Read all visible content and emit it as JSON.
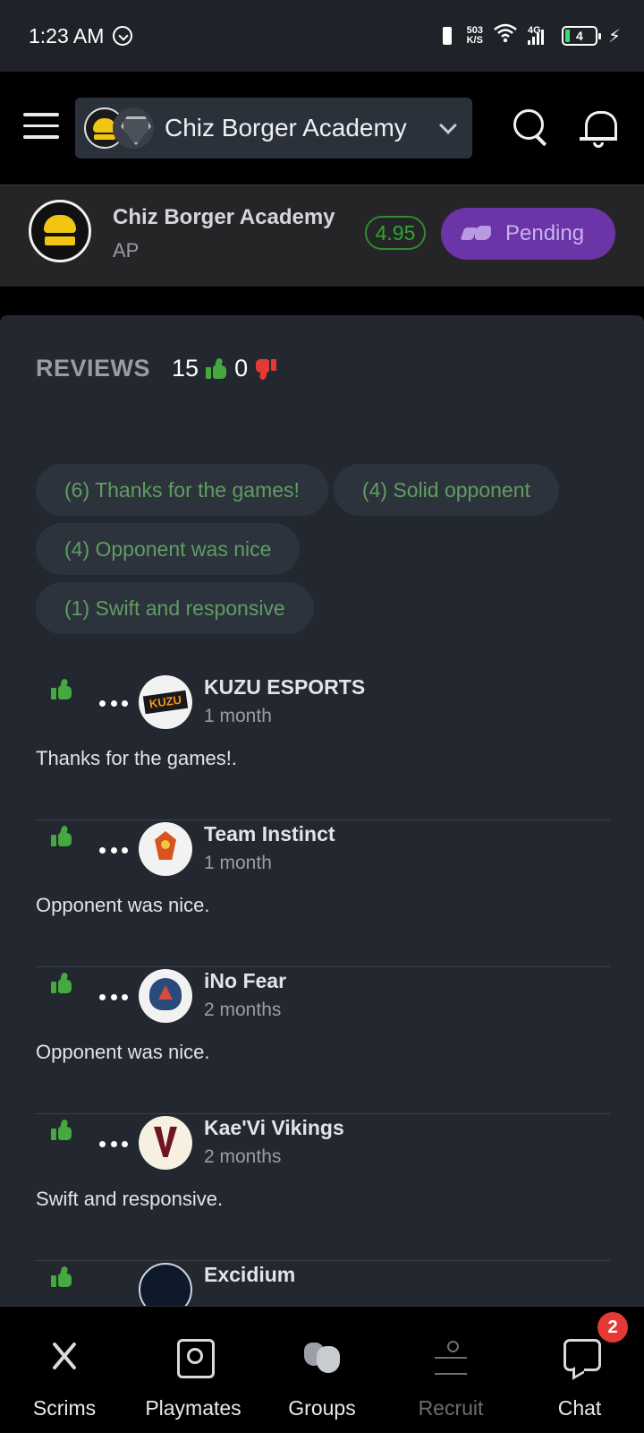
{
  "status_bar": {
    "time": "1:23 AM",
    "net_speed_value": "503",
    "net_speed_unit": "K/S",
    "network_type": "4G",
    "battery_level": "4"
  },
  "header": {
    "selected_team": "Chiz Borger Academy"
  },
  "team": {
    "name": "Chiz Borger Academy",
    "region": "AP",
    "rating": "4.95",
    "status_button": "Pending"
  },
  "reviews": {
    "title": "REVIEWS",
    "positive_count": "15",
    "negative_count": "0",
    "tags": [
      "(6) Thanks for the games!",
      "(4) Solid opponent",
      "(4) Opponent was nice",
      "(1) Swift and responsive"
    ],
    "items": [
      {
        "team": "KUZU ESPORTS",
        "time": "1 month",
        "text": "Thanks for the games!."
      },
      {
        "team": "Team Instinct",
        "time": "1 month",
        "text": "Opponent was nice."
      },
      {
        "team": "iNo Fear",
        "time": "2 months",
        "text": "Opponent was nice."
      },
      {
        "team": "Kae'Vi Vikings",
        "time": "2 months",
        "text": "Swift and responsive."
      },
      {
        "team": "Excidium",
        "time": "",
        "text": ""
      }
    ]
  },
  "nav": {
    "items": [
      {
        "label": "Scrims"
      },
      {
        "label": "Playmates"
      },
      {
        "label": "Groups"
      },
      {
        "label": "Recruit"
      },
      {
        "label": "Chat"
      }
    ],
    "chat_badge": "2"
  },
  "colors": {
    "accent_purple": "#6b35a8",
    "rating_green": "#2ea62e",
    "thumb_up": "#45a940",
    "thumb_down": "#e53935",
    "panel_bg": "#23272f"
  }
}
